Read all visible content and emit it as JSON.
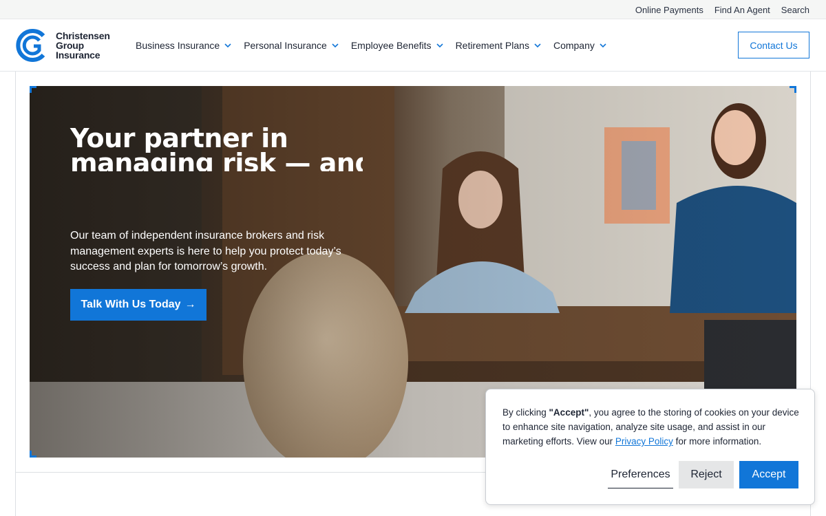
{
  "utility_links": [
    "Online Payments",
    "Find An Agent",
    "Search"
  ],
  "logo": {
    "line1": "Christensen",
    "line2": "Group",
    "line3": "Insurance",
    "brand_color": "#1176d8"
  },
  "nav": [
    {
      "label": "Business Insurance"
    },
    {
      "label": "Personal Insurance"
    },
    {
      "label": "Employee Benefits"
    },
    {
      "label": "Retirement Plans"
    },
    {
      "label": "Company"
    }
  ],
  "header": {
    "contact_label": "Contact Us"
  },
  "hero": {
    "title_line1": "Your partner in",
    "title_line2": "managing risk — and",
    "description": "Our team of independent insurance brokers and risk management experts is here to help you protect today’s success and plan for tomorrow’s growth.",
    "cta_label": "Talk With Us Today",
    "cta_arrow": "→"
  },
  "cookie": {
    "text_prefix": "By clicking ",
    "accept_quote": "\"Accept\"",
    "text_middle": ", you agree to the storing of cookies on your device to enhance site navigation, analyze site usage, and assist in our marketing efforts. View our ",
    "privacy_link": "Privacy Policy",
    "text_suffix": " for more information.",
    "preferences_label": "Preferences",
    "reject_label": "Reject",
    "accept_label": "Accept"
  },
  "icons": {
    "nav_chevron": "chevron-down-icon",
    "logo_mark": "cg-logo-icon"
  }
}
